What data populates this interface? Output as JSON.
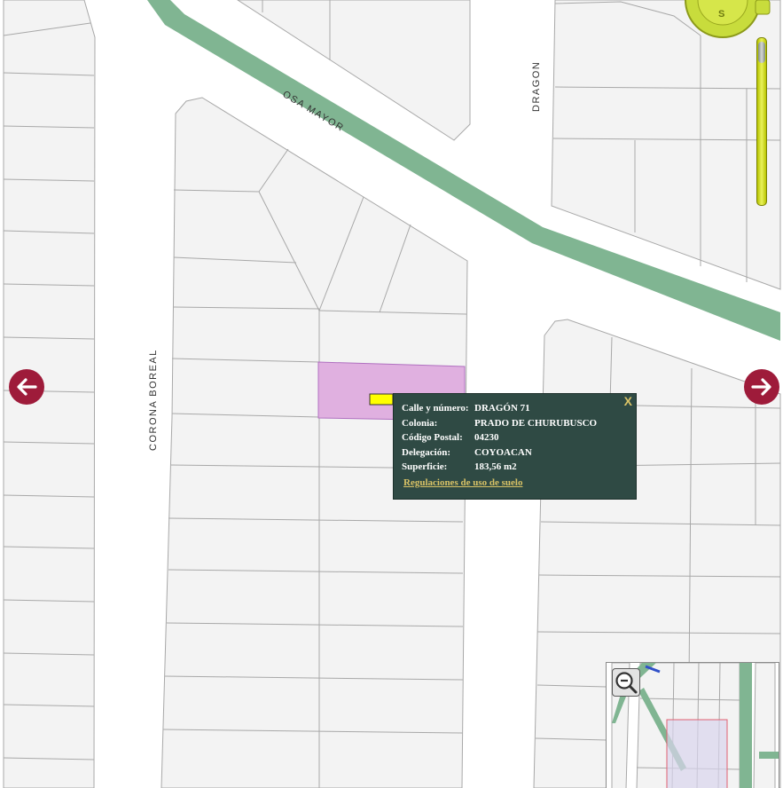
{
  "map": {
    "streets": {
      "osa_mayor": "OSA MAYOR",
      "dragon": "DRAGON",
      "corona_boreal": "CORONA BOREAL"
    },
    "colors": {
      "background": "#ffffff",
      "block_fill": "#f3f3f3",
      "lot_line": "#a8a8a8",
      "median": "#80b592",
      "selected_lot": "#e0b0e0",
      "selected_lot_border": "#b070c0",
      "nav_arrow": "#9e1b3a",
      "popup_bg": "#2f4a44",
      "popup_link": "#d8c266",
      "compass": "#c8dc3c",
      "zoom_rail": "#d8e23c"
    }
  },
  "compass": {
    "south_label": "S"
  },
  "navigation": {
    "prev_icon": "arrow-left-icon",
    "next_icon": "arrow-right-icon"
  },
  "popup": {
    "close_label": "X",
    "fields": [
      {
        "label": "Calle y número:",
        "value": "DRAGÓN 71"
      },
      {
        "label": "Colonia:",
        "value": "PRADO DE CHURUBUSCO"
      },
      {
        "label": "Código Postal:",
        "value": "04230"
      },
      {
        "label": "Delegación:",
        "value": "COYOACAN"
      },
      {
        "label": "Superficie:",
        "value": "183,56 m2"
      }
    ],
    "link_label": "Regulaciones de uso de suelo"
  },
  "overview": {
    "zoom_out_icon": "zoom-out-icon"
  }
}
